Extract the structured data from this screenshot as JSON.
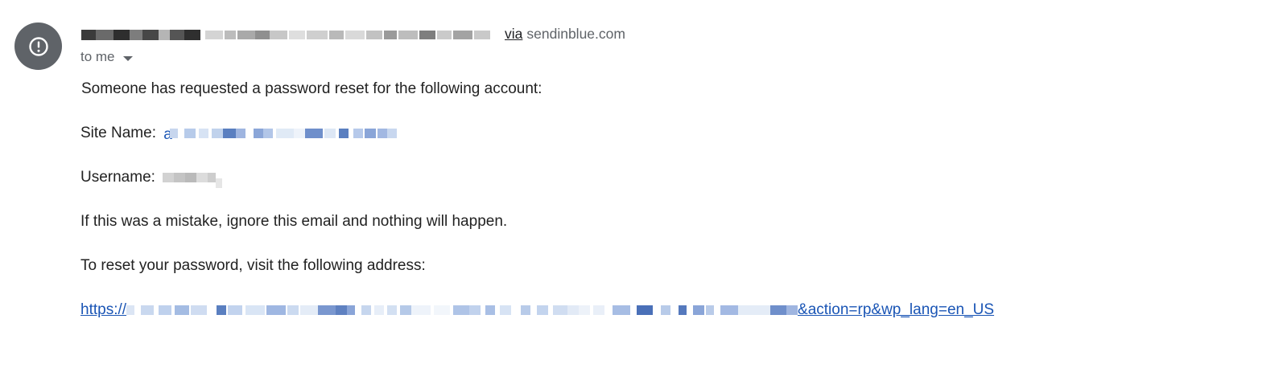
{
  "header": {
    "sender_name": "Achievable Ible",
    "sender_email": "no-reply@achievableible.example.com",
    "via_label": "via",
    "relay_domain": "sendinblue.com",
    "recipient_label": "to me",
    "avatar_icon": "alert-circle-icon"
  },
  "body": {
    "intro": "Someone has requested a password reset for the following account:",
    "site_name_label": "Site Name:",
    "site_name_first_char": "a",
    "username_label": "Username:",
    "mistake_line": "If this was a mistake, ignore this email and nothing will happen.",
    "reset_line": "To reset your password, visit the following address:",
    "reset_link_prefix": "https://",
    "reset_link_suffix": "&action=rp&wp_lang=en_US"
  },
  "colors": {
    "avatar_bg": "#5f6368",
    "link": "#1a55b5",
    "muted": "#5f6368",
    "text": "#222222"
  }
}
